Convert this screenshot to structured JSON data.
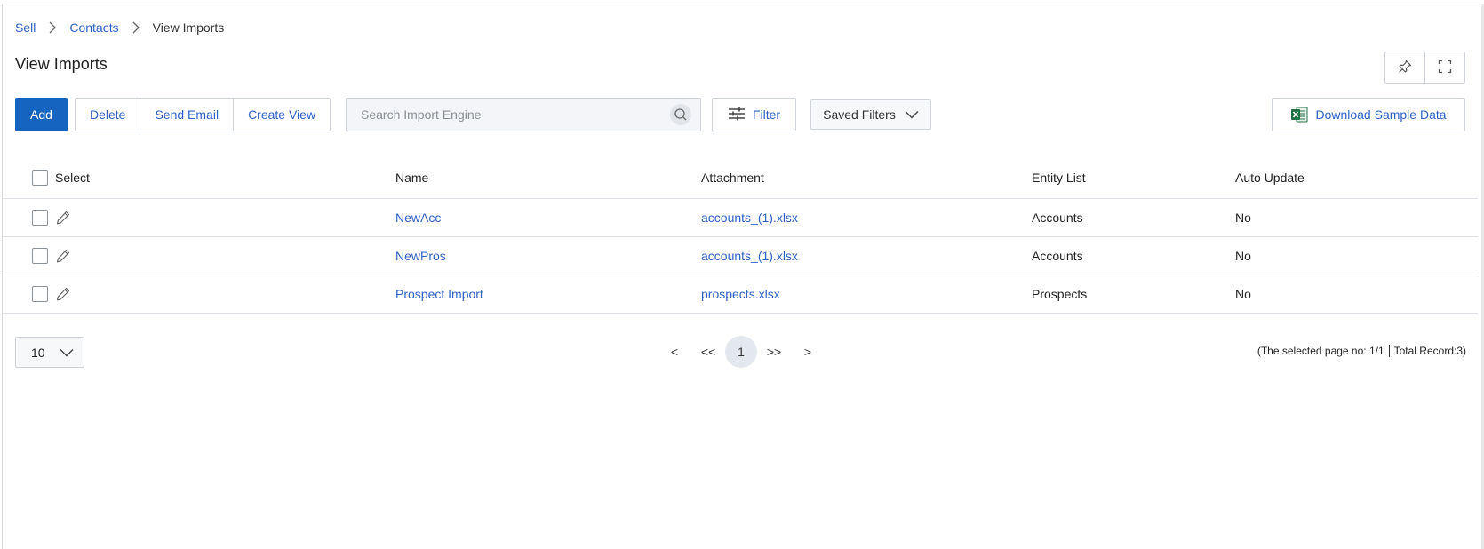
{
  "breadcrumb": {
    "items": [
      "Sell",
      "Contacts"
    ],
    "current": "View Imports"
  },
  "page": {
    "title": "View Imports"
  },
  "toolbar": {
    "add_label": "Add",
    "delete_label": "Delete",
    "send_email_label": "Send Email",
    "create_view_label": "Create View",
    "search_placeholder": "Search Import Engine",
    "filter_label": "Filter",
    "saved_filters_label": "Saved Filters",
    "download_label": "Download Sample Data"
  },
  "table": {
    "columns": {
      "select": "Select",
      "name": "Name",
      "attachment": "Attachment",
      "entity": "Entity List",
      "auto_update": "Auto Update"
    },
    "rows": [
      {
        "name": "NewAcc",
        "attachment": "accounts_(1).xlsx",
        "entity": "Accounts",
        "auto_update": "No"
      },
      {
        "name": "NewPros",
        "attachment": "accounts_(1).xlsx",
        "entity": "Accounts",
        "auto_update": "No"
      },
      {
        "name": "Prospect Import",
        "attachment": "prospects.xlsx",
        "entity": "Prospects",
        "auto_update": "No"
      }
    ]
  },
  "pagination": {
    "page_size": "10",
    "prev": "<",
    "first": "<<",
    "current_page": "1",
    "last": ">>",
    "next": ">",
    "page_info": "(The selected page no: 1/1",
    "total_info": "Total Record:3)"
  },
  "colors": {
    "primary": "#1565c0",
    "link": "#2f62c7",
    "border": "#cfd4da",
    "excel_green": "#1e7145"
  },
  "icons": [
    "chevron-right-icon",
    "pin-icon",
    "fullscreen-icon",
    "search-icon",
    "sliders-icon",
    "chevron-down-icon",
    "excel-icon",
    "pencil-icon"
  ]
}
